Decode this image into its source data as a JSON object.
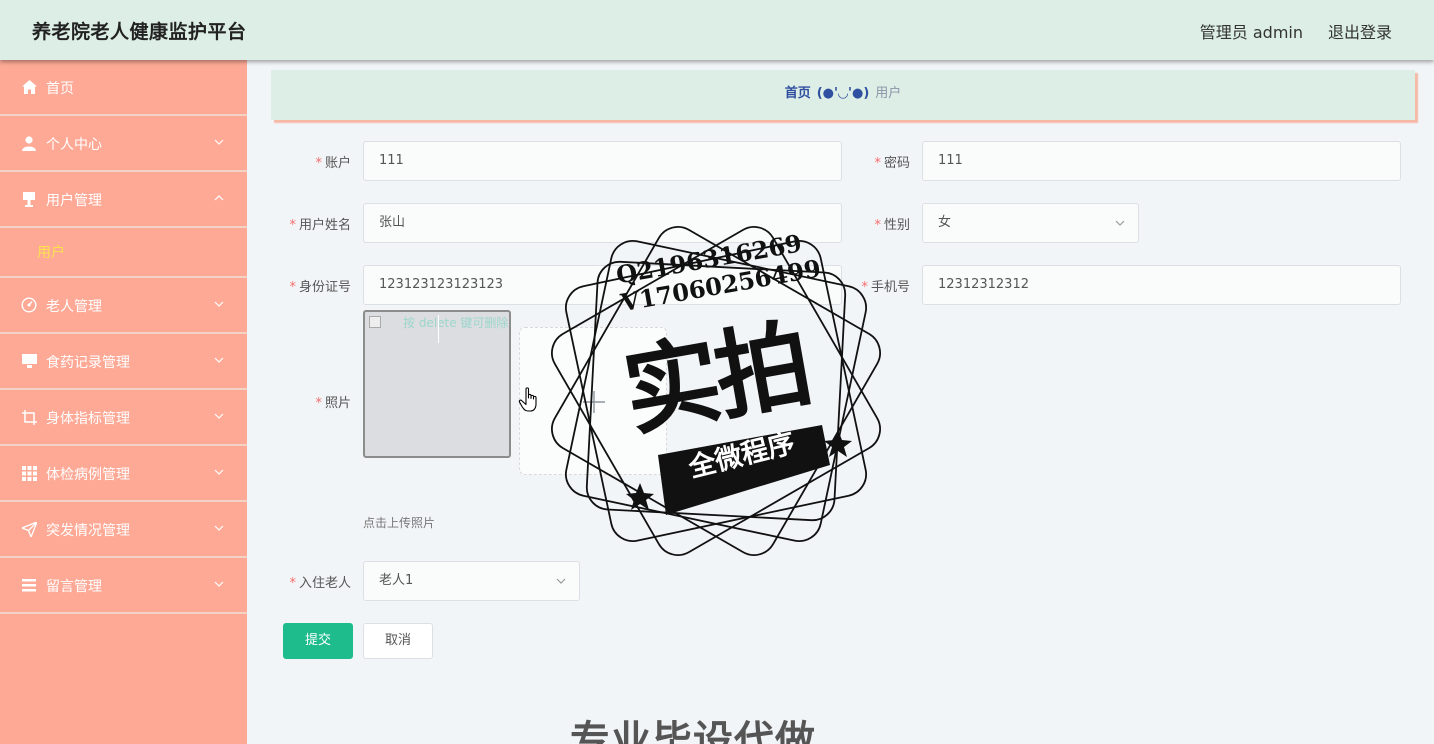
{
  "header": {
    "title": "养老院老人健康监护平台",
    "admin": "管理员 admin",
    "logout": "退出登录"
  },
  "sidebar": {
    "items": [
      {
        "label": "首页",
        "icon": "home-icon"
      },
      {
        "label": "个人中心",
        "icon": "user-icon"
      },
      {
        "label": "用户管理",
        "icon": "cup-icon",
        "expanded": true,
        "children": [
          {
            "label": "用户"
          }
        ]
      },
      {
        "label": "老人管理",
        "icon": "gauge-icon"
      },
      {
        "label": "食药记录管理",
        "icon": "monitor-icon"
      },
      {
        "label": "身体指标管理",
        "icon": "crop-icon"
      },
      {
        "label": "体检病例管理",
        "icon": "grid-icon"
      },
      {
        "label": "突发情况管理",
        "icon": "send-icon"
      },
      {
        "label": "留言管理",
        "icon": "list-icon"
      }
    ]
  },
  "breadcrumb": {
    "home": "首页",
    "face": "(●'◡'●)",
    "current": "用户"
  },
  "form": {
    "account": {
      "label": "账户",
      "value": "111"
    },
    "password": {
      "label": "密码",
      "value": "111"
    },
    "name": {
      "label": "用户姓名",
      "value": "张山"
    },
    "gender": {
      "label": "性别",
      "value": "女"
    },
    "idcard": {
      "label": "身份证号",
      "value": "123123123123123"
    },
    "phone": {
      "label": "手机号",
      "value": "12312312312"
    },
    "photo": {
      "label": "照片",
      "preview_hint": "按 delete 键可删除",
      "tip": "点击上传照片"
    },
    "elder": {
      "label": "入住老人",
      "value": "老人1"
    },
    "submit": "提交",
    "cancel": "取消"
  },
  "watermark": {
    "contact_q": "Q2196316269",
    "contact_v": "V17060256499",
    "big": "实拍",
    "ribbon": "全微程序",
    "bottom": "专业毕设代做"
  },
  "colors": {
    "header_bg": "#dceee6",
    "sidebar_bg": "#fda996",
    "active_sub": "#ffe14d",
    "primary": "#1ebb8d",
    "required": "#f56c6c"
  }
}
